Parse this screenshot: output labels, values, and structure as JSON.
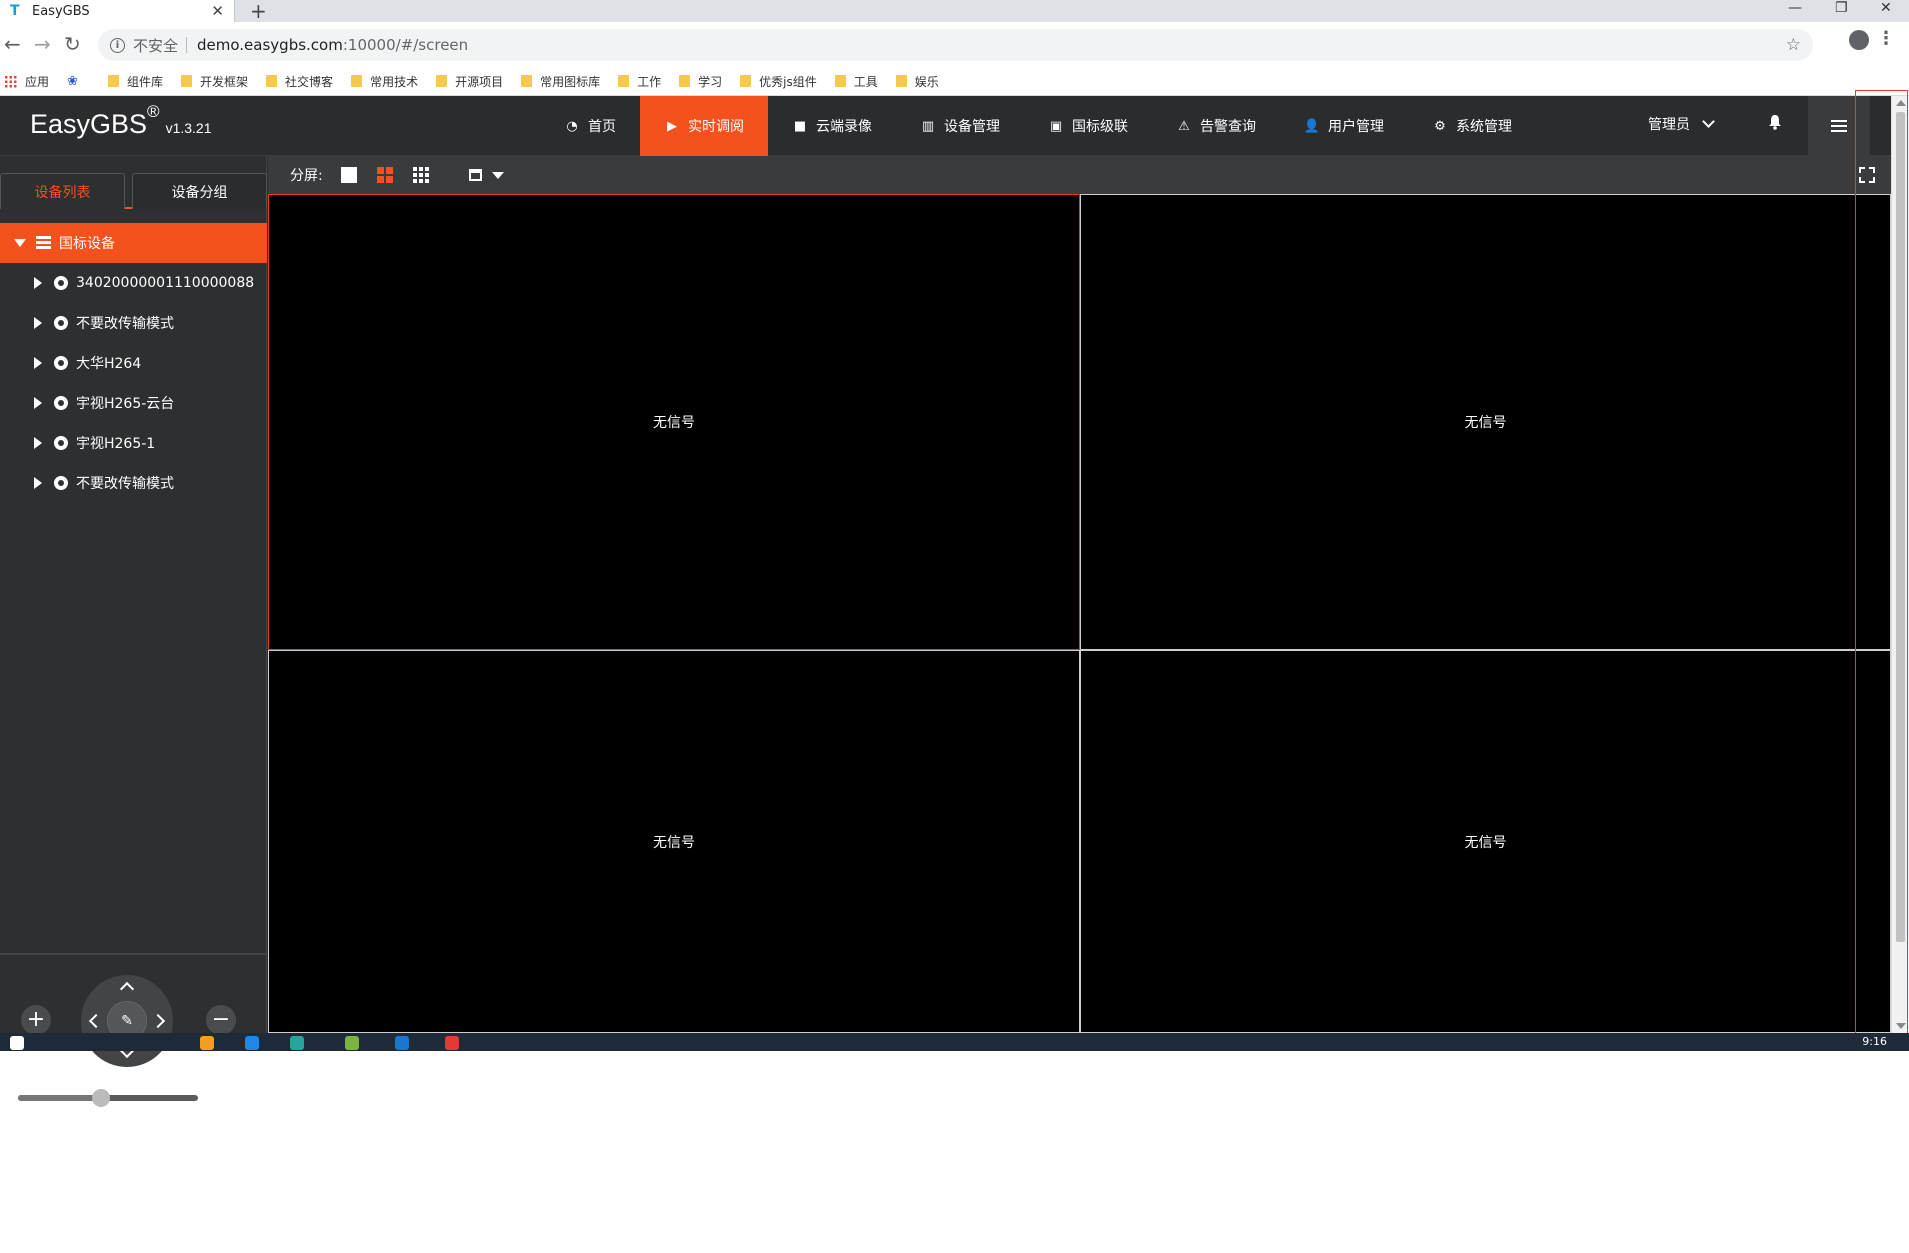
{
  "browser": {
    "tab_title": "EasyGBS",
    "tab_favicon": "T",
    "tab_close": "✕",
    "new_tab": "+",
    "win_min": "—",
    "win_max": "❐",
    "win_close": "✕",
    "back": "←",
    "forward": "→",
    "reload": "↻",
    "insecure_label": "不安全",
    "url_host": "demo.easygbs.com",
    "url_path": ":10000/#/screen",
    "star": "☆",
    "menu": "⋮",
    "bookmarks": [
      {
        "label": "应用",
        "icon": "apps-icon"
      },
      {
        "label": "",
        "icon": "paw-icon"
      },
      {
        "label": "组件库",
        "icon": "folder-icon"
      },
      {
        "label": "开发框架",
        "icon": "folder-icon"
      },
      {
        "label": "社交博客",
        "icon": "folder-icon"
      },
      {
        "label": "常用技术",
        "icon": "folder-icon"
      },
      {
        "label": "开源项目",
        "icon": "folder-icon"
      },
      {
        "label": "常用图标库",
        "icon": "folder-icon"
      },
      {
        "label": "工作",
        "icon": "folder-icon"
      },
      {
        "label": "学习",
        "icon": "folder-icon"
      },
      {
        "label": "优秀js组件",
        "icon": "folder-icon"
      },
      {
        "label": "工具",
        "icon": "folder-icon"
      },
      {
        "label": "娱乐",
        "icon": "folder-icon"
      }
    ]
  },
  "app": {
    "logo": "EasyGBS",
    "logo_mark": "®",
    "version": "v1.3.21",
    "nav": [
      {
        "label": "首页",
        "icon": "dashboard-icon",
        "glyph": "◔",
        "active": false
      },
      {
        "label": "实时调阅",
        "icon": "play-icon",
        "glyph": "▶",
        "active": true
      },
      {
        "label": "云端录像",
        "icon": "video-camera-icon",
        "glyph": "■",
        "active": false
      },
      {
        "label": "设备管理",
        "icon": "columns-icon",
        "glyph": "▥",
        "active": false
      },
      {
        "label": "国标级联",
        "icon": "cascade-icon",
        "glyph": "▣",
        "active": false
      },
      {
        "label": "告警查询",
        "icon": "alarm-icon",
        "glyph": "⚠",
        "active": false
      },
      {
        "label": "用户管理",
        "icon": "user-icon",
        "glyph": "👤",
        "active": false
      },
      {
        "label": "系统管理",
        "icon": "gear-icon",
        "glyph": "⚙",
        "active": false
      }
    ],
    "admin_label": "管理员",
    "accent": "#f4511e"
  },
  "sidebar": {
    "tabs": [
      {
        "label": "设备列表",
        "active": true
      },
      {
        "label": "设备分组",
        "active": false
      }
    ],
    "root": "国标设备",
    "devices": [
      "34020000001110000088",
      "不要改传输模式",
      "大华H264",
      "宇视H265-云台",
      "宇视H265-1",
      "不要改传输模式"
    ],
    "ptz": {
      "zoom_in": "+",
      "zoom_out": "−",
      "center_glyph": "✎",
      "speed": "129",
      "speed_fraction": 0.46
    }
  },
  "main": {
    "split_label": "分屏:",
    "panes": [
      "无信号",
      "无信号",
      "无信号",
      "无信号"
    ]
  },
  "taskbar": {
    "clock": "9:16"
  }
}
